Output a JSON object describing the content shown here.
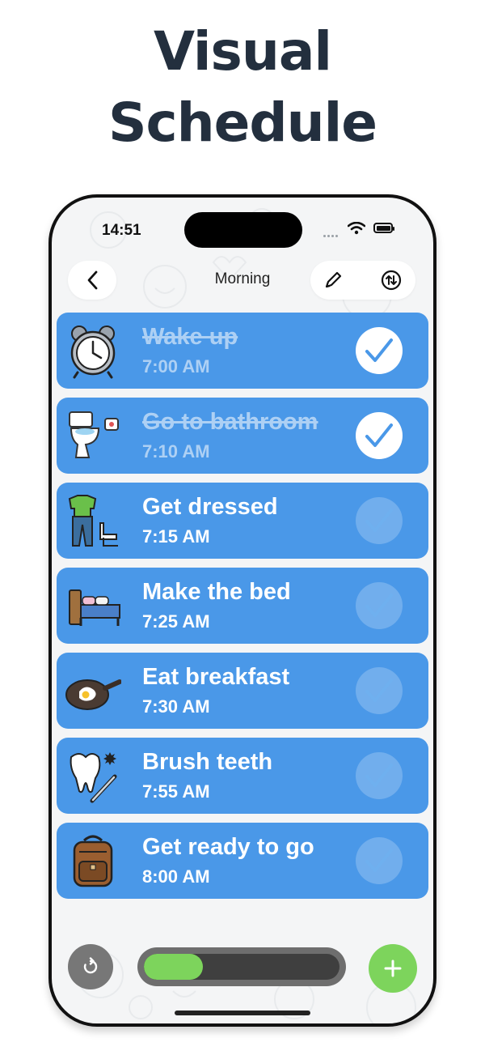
{
  "headline": {
    "line1": "Visual",
    "line2": "Schedule"
  },
  "status_bar": {
    "time": "14:51"
  },
  "nav": {
    "title": "Morning",
    "back_icon": "chevron-left-icon",
    "edit_icon": "pencil-icon",
    "reorder_icon": "swap-vertical-icon"
  },
  "tasks": [
    {
      "name": "Wake up",
      "time": "7:00 AM",
      "done": true,
      "icon": "alarm-clock-icon"
    },
    {
      "name": "Go to bathroom",
      "time": "7:10 AM",
      "done": true,
      "icon": "toilet-icon"
    },
    {
      "name": "Get dressed",
      "time": "7:15 AM",
      "done": false,
      "icon": "clothes-icon"
    },
    {
      "name": "Make the bed",
      "time": "7:25 AM",
      "done": false,
      "icon": "bed-icon"
    },
    {
      "name": "Eat breakfast",
      "time": "7:30 AM",
      "done": false,
      "icon": "frying-pan-icon"
    },
    {
      "name": "Brush teeth",
      "time": "7:55 AM",
      "done": false,
      "icon": "tooth-icon"
    },
    {
      "name": "Get ready to go",
      "time": "8:00 AM",
      "done": false,
      "icon": "backpack-icon"
    }
  ],
  "progress": {
    "fraction": 0.3
  },
  "colors": {
    "card": "#4a98e8",
    "accent_green": "#7dd45c",
    "headline": "#232f3e"
  },
  "controls": {
    "reset_icon": "refresh-icon",
    "add_icon": "plus-icon"
  }
}
